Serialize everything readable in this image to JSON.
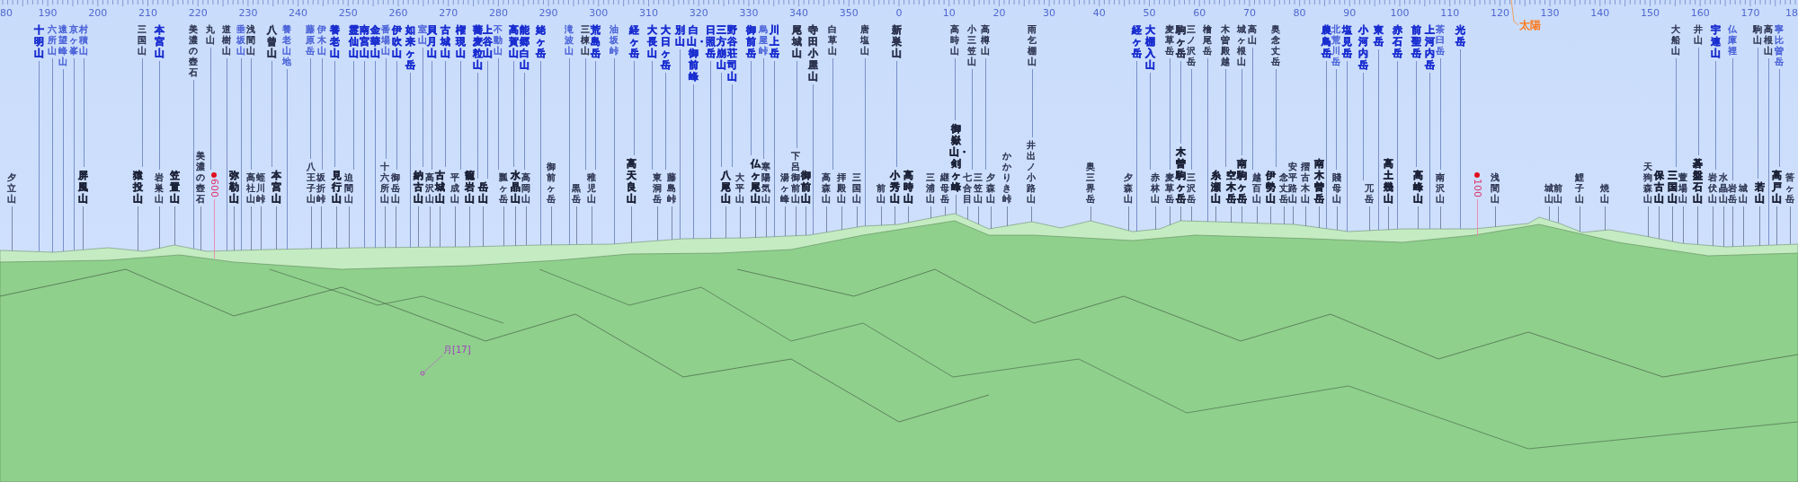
{
  "scale": {
    "ticks": [
      "80",
      "190",
      "200",
      "210",
      "220",
      "230",
      "240",
      "250",
      "260",
      "270",
      "280",
      "290",
      "300",
      "310",
      "320",
      "330",
      "340",
      "350",
      "0",
      "10",
      "20",
      "30",
      "40",
      "50",
      "60",
      "70",
      "80",
      "90",
      "100",
      "110",
      "120",
      "130",
      "140",
      "150",
      "160",
      "170",
      "18"
    ]
  },
  "sun": {
    "label": "太陽"
  },
  "upper_labels": [
    {
      "name": "十明山",
      "bold": true,
      "color": "#1a2ed0"
    },
    {
      "name": "六所山",
      "bold": false,
      "color": "#4b63d8"
    },
    {
      "name": "遠望峰山",
      "bold": false,
      "color": "#4b63d8"
    },
    {
      "name": "京ヶ峯",
      "bold": false,
      "color": "#4b63d8"
    },
    {
      "name": "村積山",
      "bold": false,
      "color": "#4b63d8"
    },
    {
      "name": "三国山",
      "bold": false,
      "color": "#2c3450"
    },
    {
      "name": "本宮山",
      "bold": true,
      "color": "#1a2ed0"
    },
    {
      "name": "美濃の壺石",
      "bold": false,
      "color": "#2c3450"
    },
    {
      "name": "丸山",
      "bold": false,
      "color": "#2c3450"
    },
    {
      "name": "道樹山",
      "bold": false,
      "color": "#2c3450"
    },
    {
      "name": "垂坂山",
      "bold": false,
      "color": "#4b63d8"
    },
    {
      "name": "浅間山",
      "bold": false,
      "color": "#2c3450"
    },
    {
      "name": "八曾山",
      "bold": true,
      "color": "#2c3450"
    },
    {
      "name": "養老山地",
      "bold": false,
      "color": "#4b63d8"
    },
    {
      "name": "藤原岳",
      "bold": false,
      "color": "#4b63d8"
    },
    {
      "name": "伊木山",
      "bold": false,
      "color": "#4b63d8"
    },
    {
      "name": "養老山",
      "bold": true,
      "color": "#1a2ed0"
    },
    {
      "name": "霊仙山",
      "bold": true,
      "color": "#1a2ed0"
    },
    {
      "name": "南宮山",
      "bold": true,
      "color": "#1a2ed0"
    },
    {
      "name": "金華山",
      "bold": true,
      "color": "#1a2ed0"
    },
    {
      "name": "番場山",
      "bold": false,
      "color": "#4b63d8"
    },
    {
      "name": "伊吹山",
      "bold": true,
      "color": "#1a2ed0"
    },
    {
      "name": "如来ヶ岳",
      "bold": true,
      "color": "#1a2ed0"
    },
    {
      "name": "室山",
      "bold": false,
      "color": "#4b63d8"
    },
    {
      "name": "貝月山",
      "bold": true,
      "color": "#1a2ed0"
    },
    {
      "name": "古城山",
      "bold": true,
      "color": "#1a2ed0"
    },
    {
      "name": "権現山",
      "bold": true,
      "color": "#1a2ed0"
    },
    {
      "name": "蕎麦粒山",
      "bold": true,
      "color": "#1a2ed0"
    },
    {
      "name": "上谷山",
      "bold": true,
      "color": "#1a2ed0"
    },
    {
      "name": "不動山",
      "bold": false,
      "color": "#4b63d8"
    },
    {
      "name": "高賀山",
      "bold": true,
      "color": "#1a2ed0"
    },
    {
      "name": "能郷白山",
      "bold": true,
      "color": "#1a2ed0"
    },
    {
      "name": "姥ヶ岳",
      "bold": true,
      "color": "#1a2ed0"
    },
    {
      "name": "滝波山",
      "bold": false,
      "color": "#4b63d8"
    },
    {
      "name": "三棟山",
      "bold": false,
      "color": "#2c3450"
    },
    {
      "name": "荒島岳",
      "bold": true,
      "color": "#1a2ed0"
    },
    {
      "name": "油坂峠",
      "bold": false,
      "color": "#4b63d8"
    },
    {
      "name": "経ヶ岳",
      "bold": true,
      "color": "#1a2ed0"
    },
    {
      "name": "大長山",
      "bold": true,
      "color": "#1a2ed0"
    },
    {
      "name": "大日ヶ岳",
      "bold": true,
      "color": "#1a2ed0"
    },
    {
      "name": "別山",
      "bold": true,
      "color": "#1a2ed0"
    },
    {
      "name": "白山・御前峰",
      "bold": true,
      "color": "#1a2ed0"
    },
    {
      "name": "日照岳",
      "bold": true,
      "color": "#1a2ed0"
    },
    {
      "name": "三方崩山",
      "bold": true,
      "color": "#1a2ed0"
    },
    {
      "name": "野谷荘司山",
      "bold": true,
      "color": "#1a2ed0"
    },
    {
      "name": "御前岳",
      "bold": true,
      "color": "#1a2ed0"
    },
    {
      "name": "烏屋峠",
      "bold": false,
      "color": "#4b63d8"
    },
    {
      "name": "川上岳",
      "bold": true,
      "color": "#1a2ed0"
    },
    {
      "name": "尾城山",
      "bold": true,
      "color": "#2c3450"
    },
    {
      "name": "寺田小屋山",
      "bold": true,
      "color": "#2c3450"
    },
    {
      "name": "白草山",
      "bold": false,
      "color": "#2c3450"
    },
    {
      "name": "唐塩山",
      "bold": false,
      "color": "#2c3450"
    },
    {
      "name": "新巣山",
      "bold": true,
      "color": "#2c3450"
    },
    {
      "name": "高時山",
      "bold": false,
      "color": "#2c3450"
    },
    {
      "name": "小三笠山",
      "bold": false,
      "color": "#2c3450"
    },
    {
      "name": "高樽山",
      "bold": false,
      "color": "#2c3450"
    },
    {
      "name": "雨乞棚山",
      "bold": false,
      "color": "#2c3450"
    },
    {
      "name": "経ヶ岳",
      "bold": true,
      "color": "#1a2ed0"
    },
    {
      "name": "大棚入山",
      "bold": true,
      "color": "#1a2ed0"
    },
    {
      "name": "麦草岳",
      "bold": false,
      "color": "#2c3450"
    },
    {
      "name": "駒ヶ岳",
      "bold": true,
      "color": "#2c3450"
    },
    {
      "name": "三ノ沢岳",
      "bold": false,
      "color": "#2c3450"
    },
    {
      "name": "檜尾岳",
      "bold": false,
      "color": "#2c3450"
    },
    {
      "name": "木曽殿越",
      "bold": false,
      "color": "#2c3450"
    },
    {
      "name": "城ヶ根山",
      "bold": false,
      "color": "#2c3450"
    },
    {
      "name": "高山",
      "bold": false,
      "color": "#2c3450"
    },
    {
      "name": "奥念丈岳",
      "bold": false,
      "color": "#2c3450"
    },
    {
      "name": "農鳥岳",
      "bold": true,
      "color": "#1a2ed0"
    },
    {
      "name": "北荒川岳",
      "bold": false,
      "color": "#4b63d8"
    },
    {
      "name": "塩見岳",
      "bold": true,
      "color": "#1a2ed0"
    },
    {
      "name": "小河内岳",
      "bold": true,
      "color": "#1a2ed0"
    },
    {
      "name": "東岳",
      "bold": true,
      "color": "#1a2ed0"
    },
    {
      "name": "赤石岳",
      "bold": true,
      "color": "#1a2ed0"
    },
    {
      "name": "前聖岳",
      "bold": true,
      "color": "#1a2ed0"
    },
    {
      "name": "上河内岳",
      "bold": true,
      "color": "#1a2ed0"
    },
    {
      "name": "茶臼岳",
      "bold": false,
      "color": "#4b63d8"
    },
    {
      "name": "光岳",
      "bold": true,
      "color": "#1a2ed0"
    },
    {
      "name": "大船山",
      "bold": false,
      "color": "#2c3450"
    },
    {
      "name": "井山",
      "bold": false,
      "color": "#2c3450"
    },
    {
      "name": "宇連山",
      "bold": true,
      "color": "#1a2ed0"
    },
    {
      "name": "仏庫裡",
      "bold": false,
      "color": "#4b63d8"
    },
    {
      "name": "駒山",
      "bold": false,
      "color": "#2c3450"
    },
    {
      "name": "高根山",
      "bold": false,
      "color": "#2c3450"
    },
    {
      "name": "寧比曽岳",
      "bold": false,
      "color": "#4b63d8"
    }
  ],
  "lower_labels": [
    {
      "name": "夕立山",
      "bold": false
    },
    {
      "name": "屏風山",
      "bold": true
    },
    {
      "name": "猿投山",
      "bold": true
    },
    {
      "name": "岩巣山",
      "bold": false
    },
    {
      "name": "笠置山",
      "bold": true
    },
    {
      "name": "美濃の壺石",
      "bold": false
    },
    {
      "name": "弥勒山",
      "bold": true
    },
    {
      "name": "高社山",
      "bold": false
    },
    {
      "name": "蛭川峠",
      "bold": false
    },
    {
      "name": "本宮山",
      "bold": true
    },
    {
      "name": "八王子山",
      "bold": false
    },
    {
      "name": "坂折峠",
      "bold": false
    },
    {
      "name": "見行山",
      "bold": true
    },
    {
      "name": "迫間山",
      "bold": false
    },
    {
      "name": "十六所山",
      "bold": false
    },
    {
      "name": "御岳山",
      "bold": false
    },
    {
      "name": "納古山",
      "bold": true
    },
    {
      "name": "高沢山",
      "bold": false
    },
    {
      "name": "古城山",
      "bold": true
    },
    {
      "name": "平成山",
      "bold": false
    },
    {
      "name": "籠岩山",
      "bold": true
    },
    {
      "name": "岳山",
      "bold": true
    },
    {
      "name": "瓢ヶ岳",
      "bold": false
    },
    {
      "name": "水晶山",
      "bold": true
    },
    {
      "name": "高岡山",
      "bold": false
    },
    {
      "name": "御前ヶ岳",
      "bold": false
    },
    {
      "name": "黒岳",
      "bold": false
    },
    {
      "name": "稚児山",
      "bold": false
    },
    {
      "name": "高天良山",
      "bold": true
    },
    {
      "name": "東洞岳",
      "bold": false
    },
    {
      "name": "藤島峠",
      "bold": false
    },
    {
      "name": "八尾山",
      "bold": true
    },
    {
      "name": "大平山",
      "bold": false
    },
    {
      "name": "仏ヶ尾山",
      "bold": true
    },
    {
      "name": "寒陽気山",
      "bold": false
    },
    {
      "name": "湯ヶ峰",
      "bold": false
    },
    {
      "name": "下呂御前山",
      "bold": false
    },
    {
      "name": "御前山",
      "bold": true
    },
    {
      "name": "高森山",
      "bold": false
    },
    {
      "name": "拝殿山",
      "bold": false
    },
    {
      "name": "三国山",
      "bold": false
    },
    {
      "name": "前山",
      "bold": false
    },
    {
      "name": "小秀山",
      "bold": true
    },
    {
      "name": "高時山",
      "bold": true
    },
    {
      "name": "三浦山",
      "bold": false
    },
    {
      "name": "継母岳",
      "bold": false
    },
    {
      "name": "御嶽山・剣ヶ峰",
      "bold": true
    },
    {
      "name": "七合目",
      "bold": false
    },
    {
      "name": "三笠山",
      "bold": false
    },
    {
      "name": "夕森山",
      "bold": false
    },
    {
      "name": "かかりき峠",
      "bold": false
    },
    {
      "name": "井出ノ小路山",
      "bold": false
    },
    {
      "name": "奥三界岳",
      "bold": false
    },
    {
      "name": "夕森山",
      "bold": false
    },
    {
      "name": "赤林山",
      "bold": false
    },
    {
      "name": "麦草岳",
      "bold": false
    },
    {
      "name": "木曽駒ヶ岳",
      "bold": true
    },
    {
      "name": "三沢岳",
      "bold": false
    },
    {
      "name": "糸瀬山",
      "bold": true
    },
    {
      "name": "空木岳",
      "bold": true
    },
    {
      "name": "南駒ヶ岳",
      "bold": true
    },
    {
      "name": "越百山",
      "bold": false
    },
    {
      "name": "伊勢山",
      "bold": true
    },
    {
      "name": "念丈岳",
      "bold": false
    },
    {
      "name": "安平路山",
      "bold": false
    },
    {
      "name": "摺古木山",
      "bold": false
    },
    {
      "name": "南木曽岳",
      "bold": true
    },
    {
      "name": "賤母山",
      "bold": false
    },
    {
      "name": "兀岳",
      "bold": false
    },
    {
      "name": "高土幾山",
      "bold": true
    },
    {
      "name": "高峰山",
      "bold": true
    },
    {
      "name": "南沢山",
      "bold": false
    },
    {
      "name": "浅間山",
      "bold": false
    },
    {
      "name": "城山",
      "bold": false
    },
    {
      "name": "前山",
      "bold": false
    },
    {
      "name": "鯉子山",
      "bold": false
    },
    {
      "name": "焼山",
      "bold": false
    },
    {
      "name": "天狗森山",
      "bold": false
    },
    {
      "name": "保古山",
      "bold": true
    },
    {
      "name": "三国山",
      "bold": true
    },
    {
      "name": "萱場山",
      "bold": false
    },
    {
      "name": "碁盤石山",
      "bold": true
    },
    {
      "name": "岩伏山",
      "bold": false
    },
    {
      "name": "水晶山",
      "bold": false
    },
    {
      "name": "岩岳",
      "bold": false
    },
    {
      "name": "城山",
      "bold": false
    },
    {
      "name": "若山",
      "bold": true
    },
    {
      "name": "高戸山",
      "bold": true
    },
    {
      "name": "筈ヶ岳",
      "bold": false
    }
  ],
  "distance_markers": [
    {
      "label": "600"
    },
    {
      "label": "100"
    }
  ],
  "moon": {
    "label": "月[17]"
  }
}
